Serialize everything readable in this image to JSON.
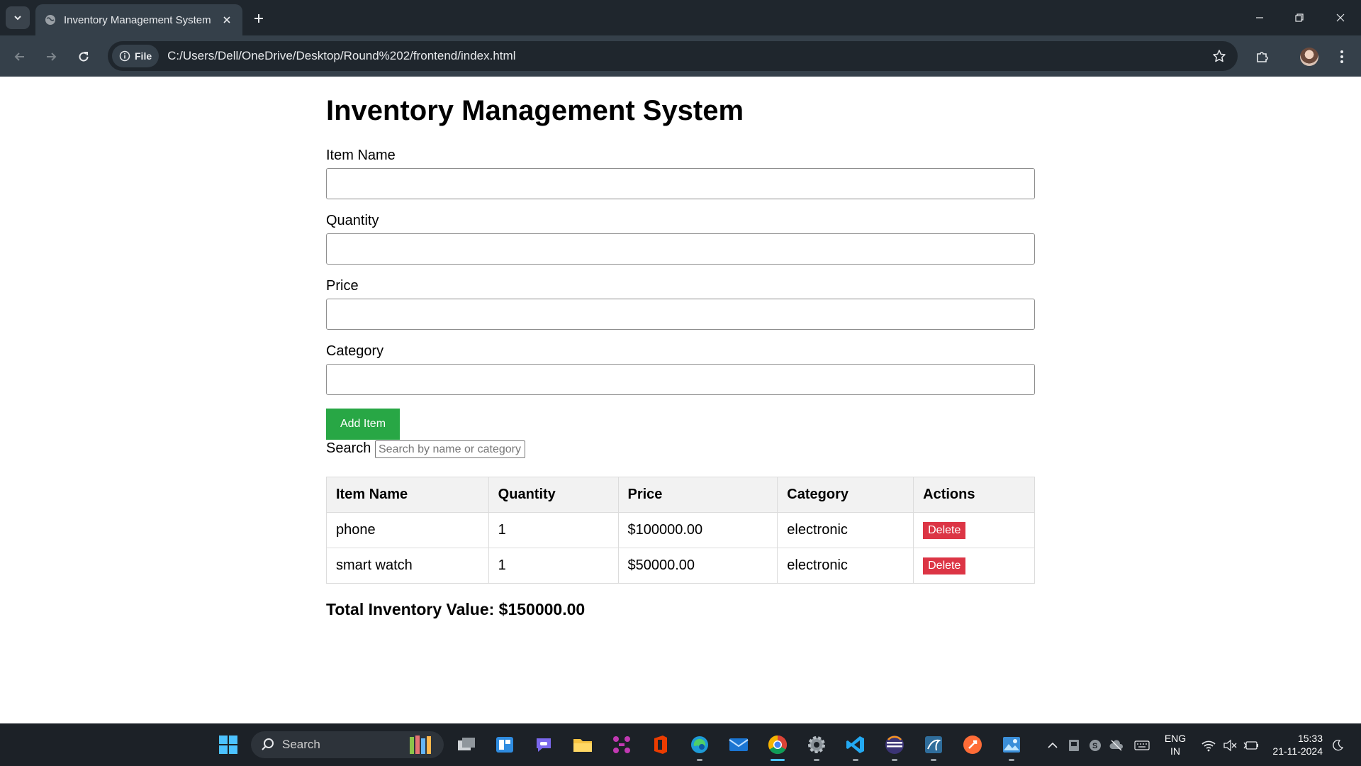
{
  "browser": {
    "tab_title": "Inventory Management System",
    "chip_label": "File",
    "url": "C:/Users/Dell/OneDrive/Desktop/Round%202/frontend/index.html"
  },
  "page": {
    "title": "Inventory Management System",
    "form": {
      "item_name_label": "Item Name",
      "item_name_value": "",
      "quantity_label": "Quantity",
      "quantity_value": "",
      "price_label": "Price",
      "price_value": "",
      "category_label": "Category",
      "category_value": "",
      "add_button": "Add Item"
    },
    "search": {
      "label": "Search",
      "placeholder": "Search by name or category",
      "value": ""
    },
    "table": {
      "headers": [
        "Item Name",
        "Quantity",
        "Price",
        "Category",
        "Actions"
      ],
      "rows": [
        {
          "name": "phone",
          "quantity": "1",
          "price": "$100000.00",
          "category": "electronic",
          "action": "Delete"
        },
        {
          "name": "smart watch",
          "quantity": "1",
          "price": "$50000.00",
          "category": "electronic",
          "action": "Delete"
        }
      ]
    },
    "total": "Total Inventory Value: $150000.00"
  },
  "taskbar": {
    "search_label": "Search",
    "language": "ENG",
    "region": "IN",
    "time": "15:33",
    "date": "21-11-2024"
  },
  "colors": {
    "add_button": "#28a745",
    "delete_button": "#dc3545",
    "browser_frame": "#1f262d",
    "browser_toolbar": "#35404a",
    "taskbar": "#1c2127"
  }
}
